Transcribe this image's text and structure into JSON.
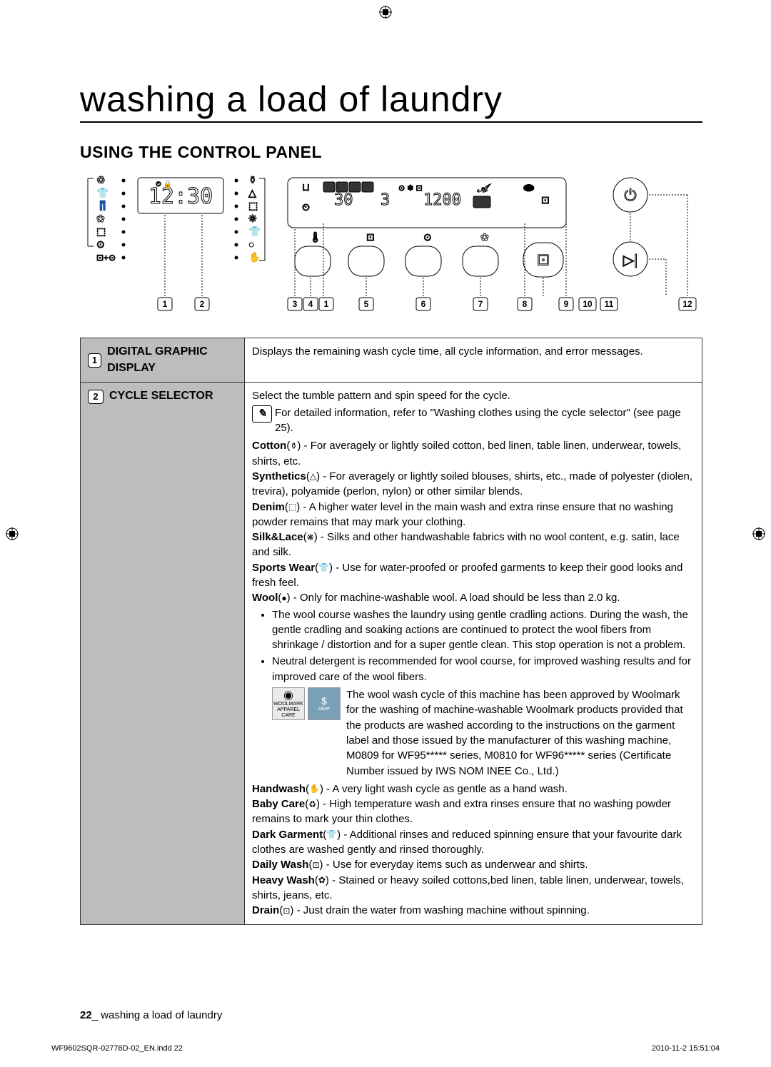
{
  "title": "washing a load of laundry",
  "section_heading": "USING THE CONTROL PANEL",
  "diagram": {
    "time_display": "12:30",
    "temp": "30",
    "rinse": "3",
    "spin": "1200",
    "callouts": [
      "1",
      "2",
      "3",
      "4",
      "1",
      "5",
      "6",
      "7",
      "8",
      "9",
      "10",
      "11",
      "12"
    ]
  },
  "rows": [
    {
      "num": "1",
      "label": "DIGITAL GRAPHIC DISPLAY",
      "body_simple": "Displays the remaining wash cycle time, all cycle information, and error messages."
    },
    {
      "num": "2",
      "label": "CYCLE SELECTOR",
      "intro": "Select the tumble pattern and spin speed for the cycle.",
      "info_note": "For detailed information, refer to \"Washing clothes using the cycle selector\" (see page 25).",
      "cycles": {
        "cotton": {
          "name": "Cotton",
          "text": " - For averagely or lightly soiled cotton, bed linen, table linen, underwear, towels, shirts, etc."
        },
        "synthetics": {
          "name": "Synthetics",
          "text": " - For averagely or lightly soiled blouses, shirts, etc., made of polyester (diolen, trevira), polyamide (perlon, nylon) or other similar blends."
        },
        "denim": {
          "name": "Denim",
          "text": " - A higher water level in the main wash and extra rinse ensure that no washing powder remains that may mark your clothing."
        },
        "silklace": {
          "name": "Silk&Lace",
          "text": " - Silks and other handwashable fabrics with no wool content, e.g. satin, lace and silk."
        },
        "sportswear": {
          "name": "Sports Wear",
          "text": " - Use for water-proofed or proofed garments to keep their good looks and fresh feel."
        },
        "wool": {
          "name": "Wool",
          "text": " - Only for machine-washable wool. A load should be less than 2.0 kg."
        },
        "handwash": {
          "name": "Handwash",
          "text": " - A very light wash cycle as gentle as a hand wash."
        },
        "babycare": {
          "name": "Baby Care",
          "text": " - High temperature wash and extra rinses ensure that no washing powder remains to mark your thin clothes."
        },
        "darkgarment": {
          "name": "Dark Garment",
          "text": " - Additional rinses and reduced spinning ensure that your favourite dark clothes are washed gently and rinsed thoroughly."
        },
        "dailywash": {
          "name": "Daily Wash",
          "text": " - Use for everyday items such as underwear and shirts."
        },
        "heavywash": {
          "name": "Heavy Wash",
          "text": " - Stained or heavy soiled cottons,bed linen, table linen, underwear, towels, shirts, jeans, etc."
        },
        "drain": {
          "name": "Drain",
          "text": " - Just drain the water from washing machine without spinning."
        }
      },
      "wool_bullets": [
        "The wool course washes the laundry using gentle cradling actions. During the wash, the gentle cradling and soaking actions are continued to protect the wool fibers from shrinkage / distortion and for a super gentle clean. This stop operation is not a problem.",
        "Neutral detergent is recommended for wool course, for improved washing results and for improved care of the wool fibers."
      ],
      "woolmark_text": "The wool wash cycle of this machine has been approved by Woolmark for the washing of machine-washable Woolmark products provided that the products are washed according to the instructions on the garment label and those issued by the manufacturer of this washing machine, M0809 for WF95***** series, M0810 for WF96***** series (Certificate Number issued by IWS NOM INEE Co., Ltd.)",
      "woolmark_badge1": "WOOLMARK APPAREL CARE",
      "woolmark_badge2": "silver"
    }
  ],
  "footer": {
    "page": "22",
    "sep": "_",
    "text": "washing a load of laundry"
  },
  "print": {
    "file": "WF9602SQR-02776D-02_EN.indd   22",
    "stamp": "2010-11-2   15:51:04"
  }
}
